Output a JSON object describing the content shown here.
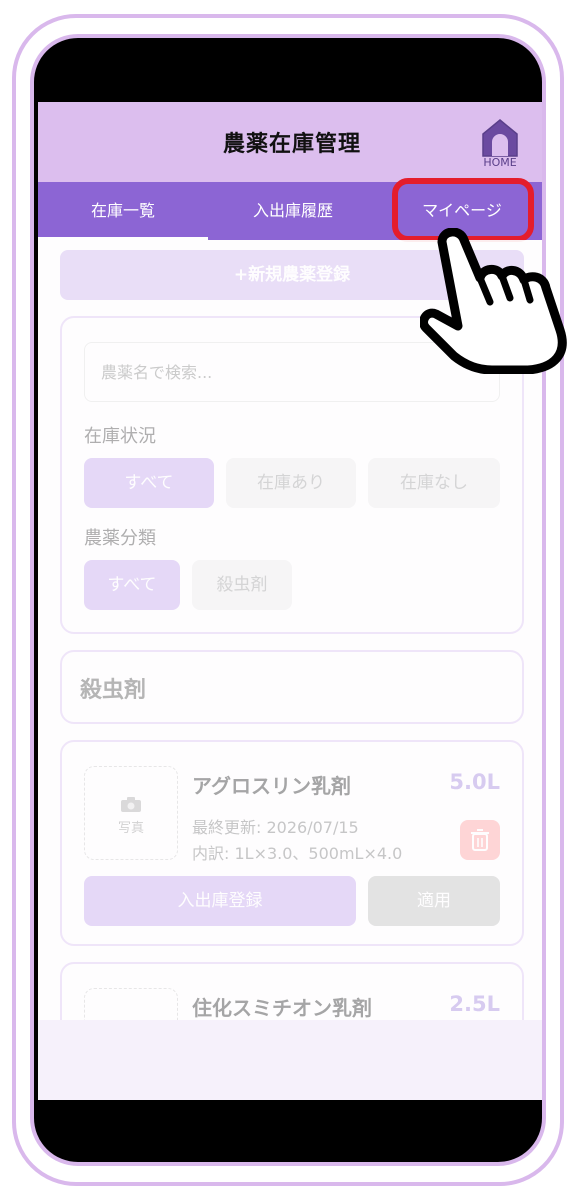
{
  "header": {
    "title": "農薬在庫管理",
    "home_label": "HOME"
  },
  "tabs": [
    {
      "label": "在庫一覧",
      "active": true
    },
    {
      "label": "入出庫履歴",
      "active": false
    },
    {
      "label": "マイページ",
      "active": false,
      "highlighted": true
    }
  ],
  "actions": {
    "new_registration": "+新規農薬登録"
  },
  "filters": {
    "search_placeholder": "農薬名で検索...",
    "stock_status_label": "在庫状況",
    "stock_status_options": [
      "すべて",
      "在庫あり",
      "在庫なし"
    ],
    "category_label": "農薬分類",
    "category_options": [
      "すべて",
      "殺虫剤"
    ]
  },
  "section": {
    "title": "殺虫剤"
  },
  "items": [
    {
      "photo_icon": "camera-icon",
      "photo_label": "写真",
      "name": "アグロスリン乳剤",
      "amount": "5.0L",
      "last_updated": "最終更新: 2026/07/15",
      "breakdown": "内訳: 1L×3.0、500mL×4.0",
      "stock_button": "入出庫登録",
      "apply_button": "適用"
    },
    {
      "name": "住化スミチオン乳剤",
      "amount": "2.5L"
    }
  ],
  "colors": {
    "header_bg": "#dcbeee",
    "tabbar_bg": "#8c65d4",
    "highlight": "#e41d2c",
    "frame": "#d9b8ec"
  }
}
